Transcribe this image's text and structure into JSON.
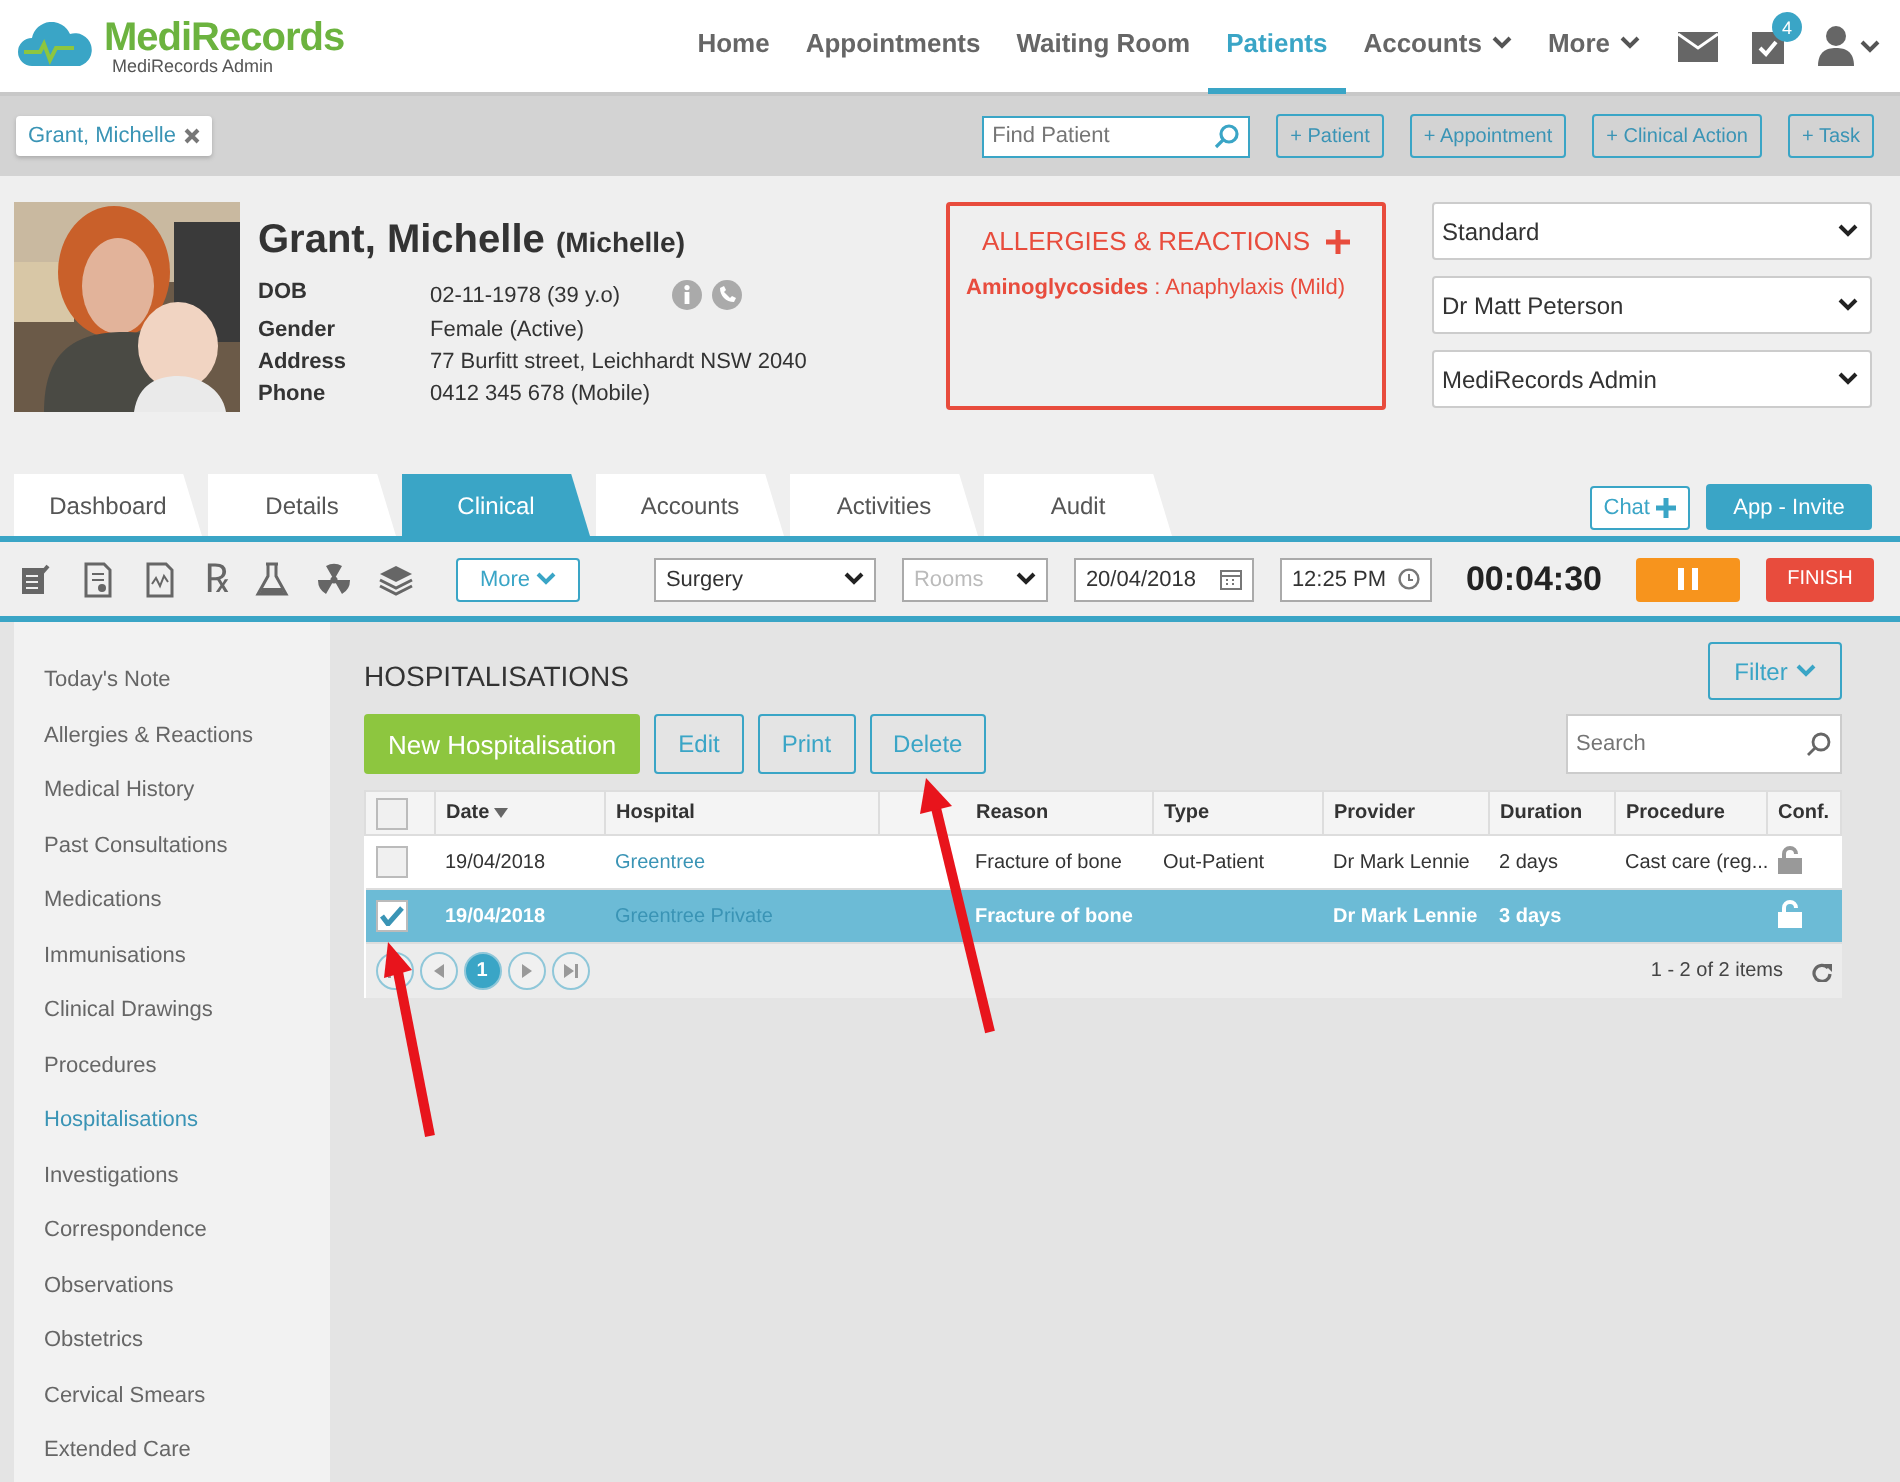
{
  "app": {
    "logo": "MediRecords",
    "logo_sub": "MediRecords Admin"
  },
  "nav": [
    {
      "label": "Home",
      "selected": false,
      "dropdown": false
    },
    {
      "label": "Appointments",
      "selected": false,
      "dropdown": false
    },
    {
      "label": "Waiting Room",
      "selected": false,
      "dropdown": false
    },
    {
      "label": "Patients",
      "selected": true,
      "dropdown": false
    },
    {
      "label": "Accounts",
      "selected": false,
      "dropdown": true
    },
    {
      "label": "More",
      "selected": false,
      "dropdown": true
    }
  ],
  "task_count": "4",
  "open_patients": [
    {
      "label": "Grant, Michelle"
    }
  ],
  "find_patient": {
    "placeholder": "Find Patient"
  },
  "quick_actions": [
    "+ Patient",
    "+ Appointment",
    "+ Clinical Action",
    "+ Task"
  ],
  "patient": {
    "name": "Grant, Michelle",
    "preferred": "(Michelle)",
    "details": [
      {
        "label": "DOB",
        "value": "02-11-1978 (39 y.o)"
      },
      {
        "label": "Gender",
        "value": "Female (Active)"
      },
      {
        "label": "Address",
        "value": "77 Burfitt street, Leichhardt NSW 2040"
      },
      {
        "label": "Phone",
        "value": "0412 345 678 (Mobile)"
      }
    ]
  },
  "allergies": {
    "title": "ALLERGIES & REACTIONS",
    "items": [
      "**Aminoglycosides** : Anaphylaxis (Mild)"
    ]
  },
  "selects": [
    "Standard",
    "Dr Matt Peterson",
    "MediRecords Admin"
  ],
  "tabs": [
    {
      "label": "Dashboard",
      "selected": false
    },
    {
      "label": "Details",
      "selected": false
    },
    {
      "label": "Clinical",
      "selected": true
    },
    {
      "label": "Accounts",
      "selected": false
    },
    {
      "label": "Activities",
      "selected": false
    },
    {
      "label": "Audit",
      "selected": false
    }
  ],
  "chat": "Chat",
  "invite": "App - Invite",
  "clinical_toolbar": {
    "rx": "℞",
    "more": "More",
    "location": "Surgery",
    "rooms_placeholder": "Rooms",
    "date": "20/04/2018",
    "time": "12:25 PM",
    "timer": "00:04:30",
    "finish": "FINISH"
  },
  "sidebar": [
    {
      "label": "Today's Note",
      "selected": false
    },
    {
      "label": "Allergies & Reactions",
      "selected": false
    },
    {
      "label": "Medical History",
      "selected": false
    },
    {
      "label": "Past Consultations",
      "selected": false
    },
    {
      "label": "Medications",
      "selected": false
    },
    {
      "label": "Immunisations",
      "selected": false
    },
    {
      "label": "Clinical Drawings",
      "selected": false
    },
    {
      "label": "Procedures",
      "selected": false
    },
    {
      "label": "Hospitalisations",
      "selected": true
    },
    {
      "label": "Investigations",
      "selected": false
    },
    {
      "label": "Correspondence",
      "selected": false
    },
    {
      "label": "Observations",
      "selected": false
    },
    {
      "label": "Obstetrics",
      "selected": false
    },
    {
      "label": "Cervical Smears",
      "selected": false
    },
    {
      "label": "Extended Care",
      "selected": false
    }
  ],
  "section": {
    "title": "HOSPITALISATIONS",
    "filter": "Filter",
    "search_placeholder": "Search",
    "actions": [
      {
        "label": "New Hospitalisation",
        "kind": "primary"
      },
      {
        "label": "Edit",
        "kind": "outline"
      },
      {
        "label": "Print",
        "kind": "outline"
      },
      {
        "label": "Delete",
        "kind": "outline"
      }
    ]
  },
  "table": {
    "columns": [
      {
        "label": "Date",
        "sorted": true
      },
      {
        "label": "Hospital",
        "sorted": false
      },
      {
        "label": "Reason",
        "sorted": false
      },
      {
        "label": "Type",
        "sorted": false
      },
      {
        "label": "Provider",
        "sorted": false
      },
      {
        "label": "Duration",
        "sorted": false
      },
      {
        "label": "Procedure",
        "sorted": false
      },
      {
        "label": "Conf.",
        "sorted": false
      }
    ],
    "all_checked": false,
    "rows": [
      {
        "selected": false,
        "checked": false,
        "date": "19/04/2018",
        "hospital": "Greentree",
        "reason": "Fracture of bone",
        "type": "Out-Patient",
        "provider": "Dr Mark Lennie",
        "duration": "2 days",
        "procedure": "Cast care (reg..."
      },
      {
        "selected": true,
        "checked": true,
        "date": "19/04/2018",
        "hospital": "Greentree Private",
        "reason": "Fracture of bone",
        "type": "",
        "provider": "Dr Mark Lennie",
        "duration": "3 days",
        "procedure": ""
      }
    ]
  },
  "pager": {
    "pages": [
      {
        "label": "1",
        "selected": true
      }
    ],
    "summary": "1 - 2 of 2 items"
  }
}
